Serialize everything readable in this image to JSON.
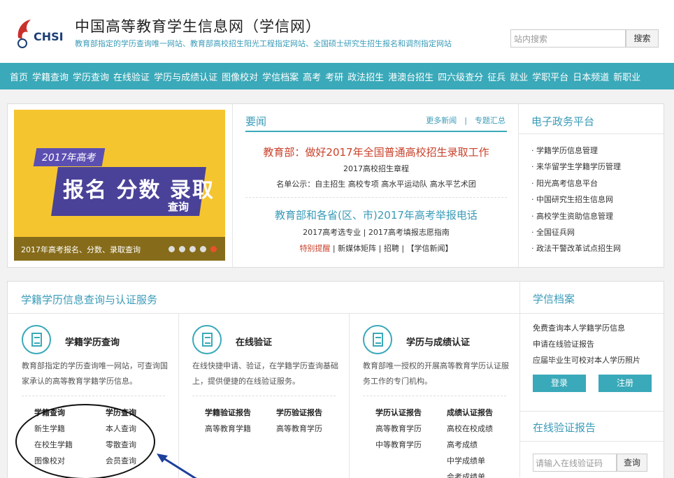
{
  "header": {
    "logo_text": "CHSI",
    "title": "中国高等教育学生信息网（学信网）",
    "subtitle": "教育部指定的学历查询唯一网站、教育部高校招生阳光工程指定网站、全国硕士研究生招生报名和调剂指定网站",
    "search_placeholder": "站内搜索",
    "search_button": "搜索"
  },
  "nav": [
    "首页",
    "学籍查询",
    "学历查询",
    "在线验证",
    "学历与成绩认证",
    "图像校对",
    "学信档案",
    "高考",
    "考研",
    "政法招生",
    "港澳台招生",
    "四六级查分",
    "征兵",
    "就业",
    "学职平台",
    "日本频道",
    "新职业"
  ],
  "banner": {
    "tag": "2017年高考",
    "headline": "报名 分数 录取",
    "sub": "查询",
    "caption": "2017年高考报名、分数、录取查询",
    "slide_count": 5,
    "active_slide": 5
  },
  "news": {
    "title": "要闻",
    "more_links": "更多新闻　|　专题汇总",
    "headline1": "教育部：做好2017年全国普通高校招生录取工作",
    "sub1": "2017高校招生章程",
    "sub2": "名单公示：自主招生 高校专项 高水平运动队 高水平艺术团",
    "headline2": "教育部和各省(区、市)2017年高考举报电话",
    "sub3": "2017高考选专业 | 2017高考填报志愿指南",
    "sub4_red": "特别提醒",
    "sub4_rest": " | 新媒体矩阵 | 招聘 | 【学信新闻】"
  },
  "egov": {
    "title": "电子政务平台",
    "items": [
      "学籍学历信息管理",
      "来华留学生学籍学历管理",
      "阳光高考信息平台",
      "中国研究生招生信息网",
      "高校学生资助信息管理",
      "全国征兵网",
      "政法干警改革试点招生网"
    ]
  },
  "services": {
    "title": "学籍学历信息查询与认证服务",
    "cards": [
      {
        "title": "学籍学历查询",
        "desc": "教育部指定的学历查询唯一网站，可查询国家承认的高等教育学籍学历信息。",
        "col1": [
          "学籍查询",
          "新生学籍",
          "在校生学籍",
          "图像校对"
        ],
        "col2": [
          "学历查询",
          "本人查询",
          "零散查询",
          "会员查询"
        ]
      },
      {
        "title": "在线验证",
        "desc": "在线快捷申请、验证，在学籍学历查询基础上，提供便捷的在线验证服务。",
        "col1": [
          "学籍验证报告",
          "高等教育学籍"
        ],
        "col2": [
          "学历验证报告",
          "高等教育学历"
        ]
      },
      {
        "title": "学历与成绩认证",
        "desc": "教育部唯一授权的开展高等教育学历认证服务工作的专门机构。",
        "col1": [
          "学历认证报告",
          "高等教育学历",
          "中等教育学历"
        ],
        "col2": [
          "成绩认证报告",
          "高校在校成绩",
          "高考成绩",
          "中学成绩单",
          "会考成绩单"
        ]
      }
    ]
  },
  "archive": {
    "title": "学信档案",
    "lines": [
      "免费查询本人学籍学历信息",
      "申请在线验证报告",
      "应届毕业生可校对本人学历照片"
    ],
    "login": "登录",
    "register": "注册"
  },
  "verify": {
    "title": "在线验证报告",
    "placeholder": "请输入在线验证码",
    "button": "查询"
  }
}
